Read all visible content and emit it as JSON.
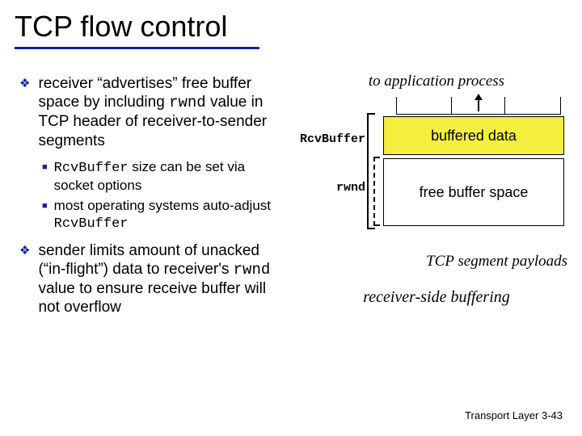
{
  "title": "TCP flow control",
  "bullets": {
    "b1_pre": "receiver “advertises” free buffer space by including ",
    "b1_code": "rwnd",
    "b1_post": " value in TCP header of receiver-to-sender segments",
    "s1_code": "RcvBuffer",
    "s1_rest": " size can be set via socket options",
    "s2_pre": "most operating systems auto-adjust ",
    "s2_code": "RcvBuffer",
    "b2_pre": "sender limits amount of unacked (“in-flight”) data to receiver's ",
    "b2_code": "rwnd",
    "b2_post": " value to ensure receive buffer will not overflow"
  },
  "diagram": {
    "to_app": "to application process",
    "rcvbuffer": "RcvBuffer",
    "rwnd": "rwnd",
    "buffered": "buffered data",
    "free": "free buffer space",
    "payloads": "TCP segment payloads",
    "caption": "receiver-side buffering"
  },
  "footer": {
    "chapter": "Transport Layer",
    "page": "3-43"
  }
}
